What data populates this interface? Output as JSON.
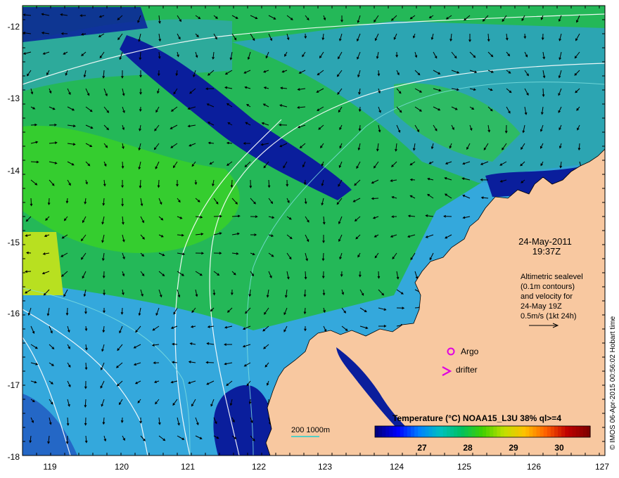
{
  "map": {
    "lon_ticks": [
      "119",
      "120",
      "121",
      "122",
      "123",
      "124",
      "125",
      "126",
      "127"
    ],
    "lat_ticks": [
      "-12",
      "-13",
      "-14",
      "-15",
      "-16",
      "-17",
      "-18"
    ],
    "date": "24-May-2011",
    "time": "19:37Z",
    "legend_lines": [
      "Altimetric sealevel",
      "(0.1m contours)",
      "and velocity for",
      "24-May 19Z",
      "0.5m/s (1kt 24h)"
    ],
    "argo_label": "Argo",
    "drifter_label": "drifter",
    "bathymetry_label": "200  1000m",
    "colorbar": {
      "title": "Temperature (°C) NOAA15_L3U 38% ql>=4",
      "ticks": [
        "27",
        "28",
        "29",
        "30"
      ],
      "colors": [
        "#00007f",
        "#0000ff",
        "#0080ff",
        "#00c0c0",
        "#00c060",
        "#40d000",
        "#c0e000",
        "#ffc000",
        "#ff6000",
        "#c00000",
        "#800000"
      ]
    },
    "credit": "© IMOS 06-Apr-2015 00:56:02 Hobart time",
    "colors": {
      "land": "#f8c8a0",
      "ocean_warm": "#20c040",
      "ocean_cool": "#30a8e0",
      "ocean_cold": "#0a1e9c",
      "argo": "#e000e0"
    }
  }
}
